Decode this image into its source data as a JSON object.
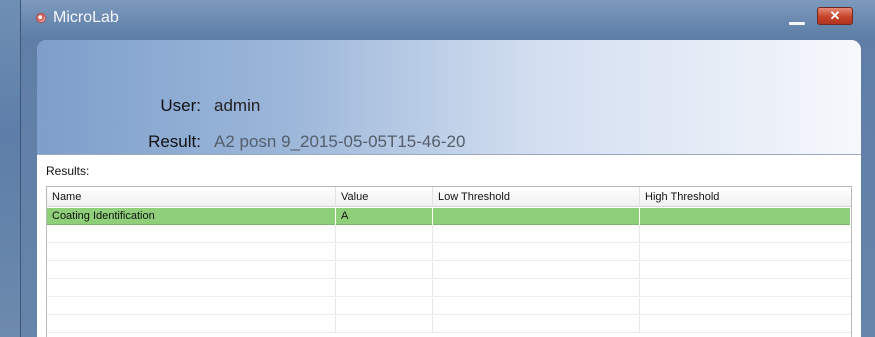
{
  "window": {
    "title": "MicroLab",
    "close_glyph": "✕",
    "icons": [
      "app-icon",
      "minimize-icon",
      "close-icon"
    ]
  },
  "header": {
    "user_label": "User:",
    "user_value": "admin",
    "result_label": "Result:",
    "result_value": "A2 posn 9_2015-05-05T15-46-20"
  },
  "results": {
    "label": "Results:",
    "columns": [
      "Name",
      "Value",
      "Low Threshold",
      "High Threshold"
    ],
    "rows": [
      {
        "name": "Coating Identification",
        "value": "A",
        "low": "",
        "high": "",
        "selected": true
      },
      {
        "name": "",
        "value": "",
        "low": "",
        "high": "",
        "selected": false
      },
      {
        "name": "",
        "value": "",
        "low": "",
        "high": "",
        "selected": false
      },
      {
        "name": "",
        "value": "",
        "low": "",
        "high": "",
        "selected": false
      },
      {
        "name": "",
        "value": "",
        "low": "",
        "high": "",
        "selected": false
      },
      {
        "name": "",
        "value": "",
        "low": "",
        "high": "",
        "selected": false
      },
      {
        "name": "",
        "value": "",
        "low": "",
        "high": "",
        "selected": false
      }
    ]
  },
  "colors": {
    "selected_row": "#8fcf7a",
    "window_chrome": "#6784aa"
  }
}
